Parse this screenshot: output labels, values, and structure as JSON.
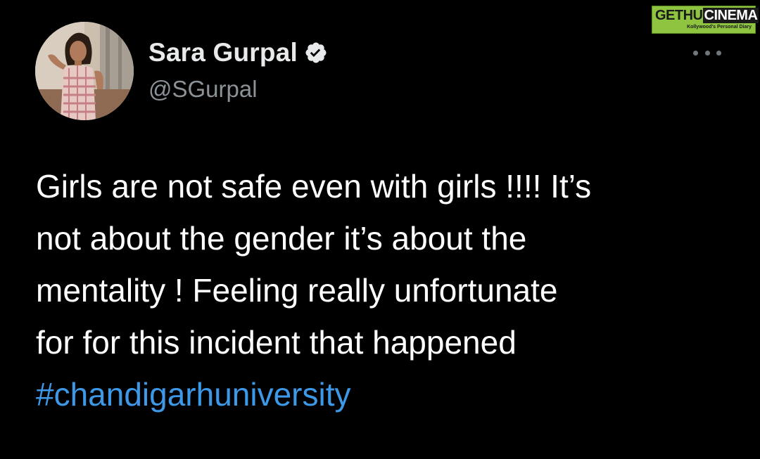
{
  "author": {
    "display_name": "Sara Gurpal",
    "handle": "@SGurpal",
    "verified": true
  },
  "tweet": {
    "lines": [
      "Girls are not safe even with girls !!!! It’s",
      "not about the gender it’s about the",
      "mentality ! Feeling really unfortunate",
      "for for this incident that happened"
    ],
    "hashtag": "#chandigarhuniversity"
  },
  "icons": {
    "verified": "verified-badge-icon",
    "more": "more-options-icon"
  },
  "watermark": {
    "title_a": "GETHU",
    "title_b": "CINEMA",
    "subtitle": "Kollywood's Personal Diary"
  },
  "colors": {
    "background": "#000000",
    "text": "#ffffff",
    "handle": "#8b9298",
    "hashtag": "#3d98e8",
    "watermark": "#8ec43f"
  }
}
